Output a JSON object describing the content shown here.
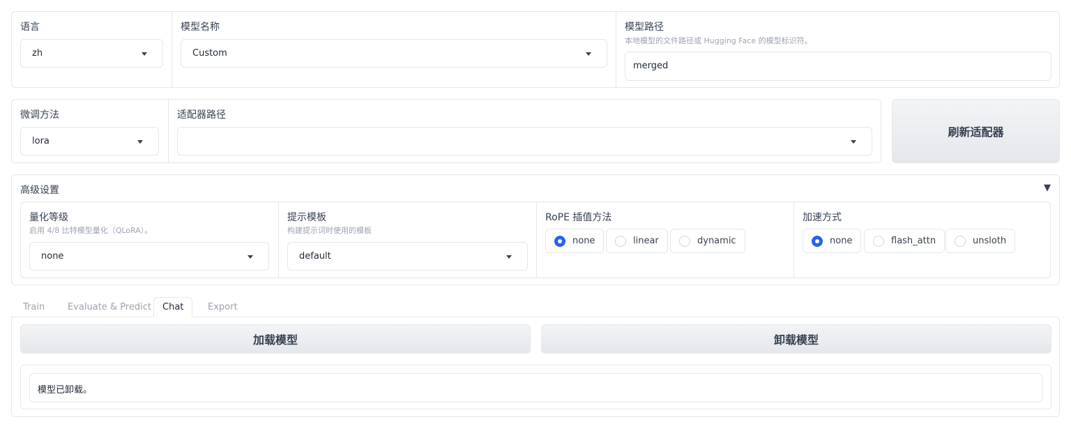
{
  "top": {
    "language": {
      "label": "语言",
      "value": "zh"
    },
    "model_name": {
      "label": "模型名称",
      "value": "Custom"
    },
    "model_path": {
      "label": "模型路径",
      "info": "本地模型的文件路径或 Hugging Face 的模型标识符。",
      "value": "merged"
    }
  },
  "adapter": {
    "finetune": {
      "label": "微调方法",
      "value": "lora"
    },
    "path": {
      "label": "适配器路径",
      "value": ""
    },
    "refresh_label": "刷新适配器"
  },
  "advanced": {
    "title": "高级设置",
    "toggle_glyph": "▼",
    "quant": {
      "label": "量化等级",
      "info": "启用 4/8 比特模型量化（QLoRA）。",
      "value": "none"
    },
    "template": {
      "label": "提示模板",
      "info": "构建提示词时使用的模板",
      "value": "default"
    },
    "rope": {
      "label": "RoPE 插值方法",
      "options": [
        "none",
        "linear",
        "dynamic"
      ],
      "selected": "none"
    },
    "booster": {
      "label": "加速方式",
      "options": [
        "none",
        "flash_attn",
        "unsloth"
      ],
      "selected": "none"
    }
  },
  "tabs": [
    "Train",
    "Evaluate & Predict",
    "Chat",
    "Export"
  ],
  "active_tab": "Chat",
  "chat": {
    "load_label": "加载模型",
    "unload_label": "卸载模型",
    "info_text": "模型已卸载。"
  },
  "colors": {
    "accent": "#2563eb",
    "border": "#e5e7eb"
  }
}
